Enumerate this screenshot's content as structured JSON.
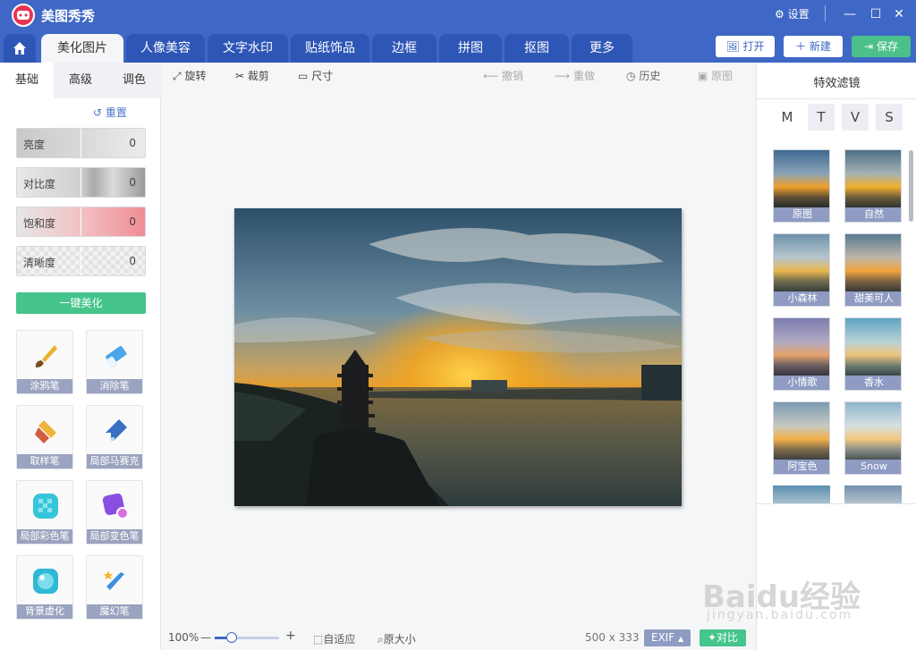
{
  "app": {
    "title": "美图秀秀",
    "logo_text": "meitu",
    "settings_label": "设置"
  },
  "colors": {
    "accent": "#3f67c5",
    "save": "#4bc08a",
    "onekey": "#45c48c",
    "filter_label": "#8f9bc3"
  },
  "tabs": [
    "美化图片",
    "人像美容",
    "文字水印",
    "贴纸饰品",
    "边框",
    "拼图",
    "抠图",
    "更多"
  ],
  "header_buttons": {
    "open": "打开",
    "new": "新建",
    "save": "保存"
  },
  "left": {
    "subtabs": [
      "基础",
      "高级",
      "调色"
    ],
    "reset": "重置",
    "sliders": [
      {
        "label": "亮度",
        "value": "0"
      },
      {
        "label": "对比度",
        "value": "0"
      },
      {
        "label": "饱和度",
        "value": "0"
      },
      {
        "label": "清晰度",
        "value": "0"
      }
    ],
    "onekey": "一键美化",
    "tools": [
      "涂鸦笔",
      "消除笔",
      "取样笔",
      "局部马赛克",
      "局部彩色笔",
      "局部变色笔",
      "背景虚化",
      "魔幻笔"
    ]
  },
  "toolbar": {
    "rotate": "旋转",
    "crop": "裁剪",
    "size": "尺寸",
    "undo": "撤销",
    "redo": "重做",
    "history": "历史",
    "original": "原图"
  },
  "bottom": {
    "zoom": "100%",
    "fit": "自适应",
    "actual": "原大小",
    "dimensions": "500 x 333",
    "exif": "EXIF",
    "compare": "对比"
  },
  "right": {
    "title": "特效滤镜",
    "letters": [
      "M",
      "T",
      "V",
      "S"
    ],
    "filters": [
      "原图",
      "自然",
      "小森林",
      "甜美可人",
      "小情歌",
      "香水",
      "阿宝色",
      "Snow"
    ]
  },
  "watermark": {
    "brand": "Baidu经验",
    "url": "jingyan.baidu.com"
  }
}
